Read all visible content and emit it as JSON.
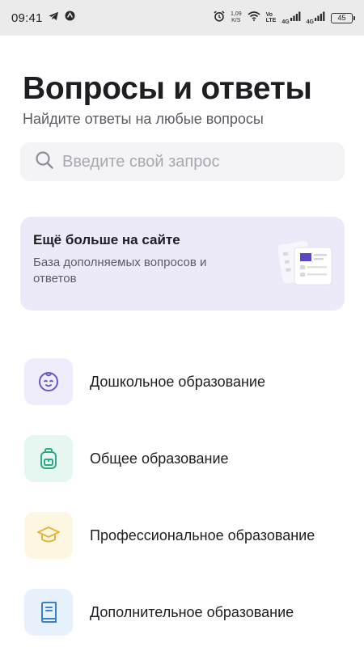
{
  "status_bar": {
    "time": "09:41",
    "net_speed_value": "1,09",
    "net_speed_unit": "K/S",
    "volte_top": "Vo",
    "volte_bottom": "LTE",
    "signal_label_1": "4G",
    "signal_label_2": "4G",
    "battery": "45"
  },
  "header": {
    "title": "Вопросы и ответы",
    "subtitle": "Найдите ответы на любые вопросы"
  },
  "search": {
    "placeholder": "Введите свой запрос",
    "icon": "search-icon"
  },
  "promo": {
    "title": "Ещё больше на сайте",
    "text": "База дополняемых вопросов и ответов",
    "accent_color": "#5b46c8"
  },
  "categories": [
    {
      "label": "Дошкольное образование",
      "icon": "baby-face-icon",
      "color": "#6a55c8",
      "bg": "#efedfb"
    },
    {
      "label": "Общее образование",
      "icon": "backpack-icon",
      "color": "#2fa787",
      "bg": "#e6f7f1"
    },
    {
      "label": "Профессиональное образование",
      "icon": "graduation-cap-icon",
      "color": "#e5b43a",
      "bg": "#fdf7e2"
    },
    {
      "label": "Дополнительное образование",
      "icon": "book-icon",
      "color": "#3b82c4",
      "bg": "#e6f1fb"
    }
  ]
}
